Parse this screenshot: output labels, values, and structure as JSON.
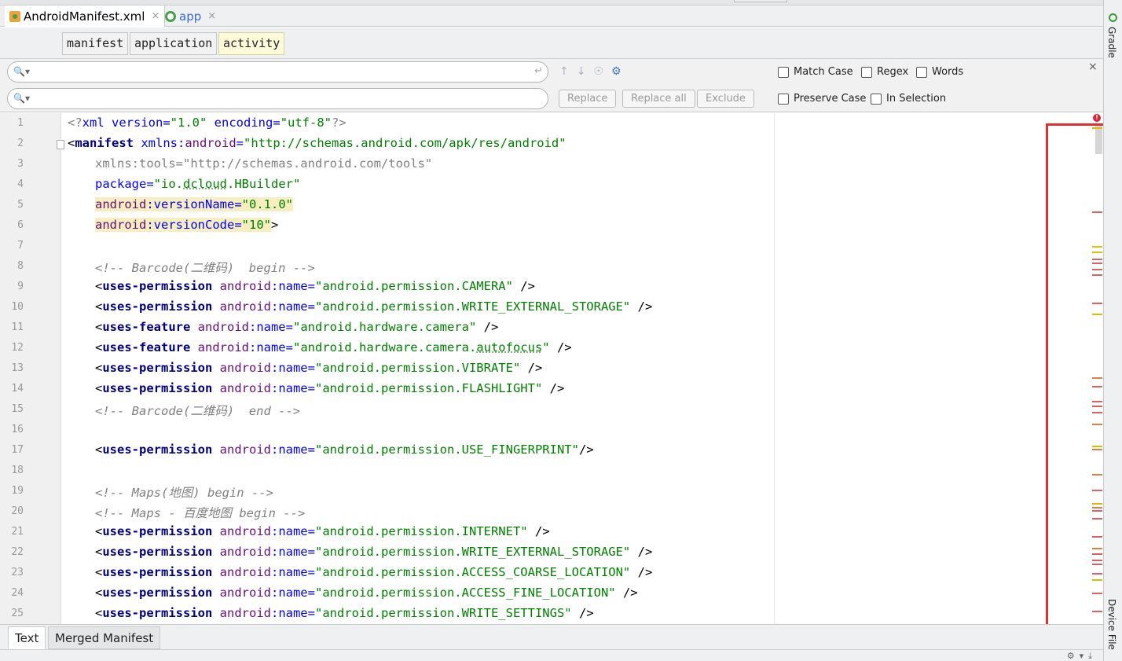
{
  "editor_tabs": [
    {
      "label": "AndroidManifest.xml",
      "icon": "xml-file-icon",
      "active": true
    },
    {
      "label": "app",
      "icon": "android-module-icon",
      "active": false
    }
  ],
  "close_glyph": "×",
  "breadcrumbs": [
    "manifest",
    "application",
    "activity"
  ],
  "find": {
    "search_value": "",
    "replace_value": "",
    "buttons": {
      "replace": "Replace",
      "replace_all": "Replace all",
      "exclude": "Exclude"
    },
    "options": {
      "match_case": "Match Case",
      "regex": "Regex",
      "words": "Words",
      "preserve_case": "Preserve Case",
      "in_selection": "In Selection"
    },
    "close": "×"
  },
  "gutter_lines": [
    "1",
    "2",
    "3",
    "4",
    "5",
    "6",
    "7",
    "8",
    "9",
    "10",
    "11",
    "12",
    "13",
    "14",
    "15",
    "16",
    "17",
    "18",
    "19",
    "20",
    "21",
    "22",
    "23",
    "24",
    "25"
  ],
  "code": {
    "l1": {
      "a": "<?",
      "b": "xml",
      "c": " version",
      "d": "=",
      "e": "\"1.0\"",
      "f": " encoding",
      "g": "=",
      "h": "\"utf-8\"",
      "i": "?>"
    },
    "l2": {
      "a": "<",
      "b": "manifest",
      "c": " xmlns:",
      "d": "android",
      "e": "=",
      "f": "\"http://schemas.android.com/apk/res/android\""
    },
    "l3": {
      "a": "xmlns:tools=\"http://schemas.android.com/tools\""
    },
    "l4": {
      "a": "package",
      "b": "=",
      "c": "\"io.",
      "d": "dcloud",
      "e": ".HBuilder\""
    },
    "l5": {
      "a": "android",
      "b": ":",
      "c": "versionName",
      "d": "=",
      "e": "\"0.1.0\""
    },
    "l6": {
      "a": "android",
      "b": ":",
      "c": "versionCode",
      "d": "=",
      "e": "\"10\"",
      "f": ">"
    },
    "l8": {
      "a": "<!-- Barcode(二维码)  begin -->"
    },
    "l9": {
      "a": "<",
      "b": "uses-permission",
      "c": " android",
      "d": ":name",
      "e": "=",
      "f": "\"android.permission.CAMERA\"",
      "g": " />"
    },
    "l10": {
      "a": "<",
      "b": "uses-permission",
      "c": " android",
      "d": ":name",
      "e": "=",
      "f": "\"android.permission.WRITE_EXTERNAL_STORAGE\"",
      "g": " />"
    },
    "l11": {
      "a": "<",
      "b": "uses-feature",
      "c": " android",
      "d": ":name",
      "e": "=",
      "f": "\"android.hardware.camera\"",
      "g": " />"
    },
    "l12": {
      "a": "<",
      "b": "uses-feature",
      "c": " android",
      "d": ":name",
      "e": "=",
      "f": "\"android.hardware.camera.",
      "h": "autofocus",
      "i": "\"",
      "g": " />"
    },
    "l13": {
      "a": "<",
      "b": "uses-permission",
      "c": " android",
      "d": ":name",
      "e": "=",
      "f": "\"android.permission.VIBRATE\"",
      "g": " />"
    },
    "l14": {
      "a": "<",
      "b": "uses-permission",
      "c": " android",
      "d": ":name",
      "e": "=",
      "f": "\"android.permission.FLASHLIGHT\"",
      "g": " />"
    },
    "l15": {
      "a": "<!-- Barcode(二维码)  end -->"
    },
    "l17": {
      "a": "<",
      "b": "uses-permission",
      "c": " android",
      "d": ":name",
      "e": "=",
      "f": "\"android.permission.USE_FINGERPRINT\"",
      "g": "/>"
    },
    "l19": {
      "a": "<!-- Maps(地图) begin -->"
    },
    "l20": {
      "a": "<!-- Maps - 百度地图 begin -->"
    },
    "l21": {
      "a": "<",
      "b": "uses-permission",
      "c": " android",
      "d": ":name",
      "e": "=",
      "f": "\"android.permission.INTERNET\"",
      "g": " />"
    },
    "l22": {
      "a": "<",
      "b": "uses-permission",
      "c": " android",
      "d": ":name",
      "e": "=",
      "f": "\"android.permission.WRITE_EXTERNAL_STORAGE\"",
      "g": " />"
    },
    "l23": {
      "a": "<",
      "b": "uses-permission",
      "c": " android",
      "d": ":name",
      "e": "=",
      "f": "\"android.permission.ACCESS_COARSE_LOCATION\"",
      "g": " />"
    },
    "l24": {
      "a": "<",
      "b": "uses-permission",
      "c": " android",
      "d": ":name",
      "e": "=",
      "f": "\"android.permission.ACCESS_FINE_LOCATION\"",
      "g": " />"
    },
    "l25": {
      "a": "<",
      "b": "uses-permission",
      "c": " android",
      "d": ":name",
      "e": "=",
      "f": "\"android.permission.WRITE_SETTINGS\"",
      "g": " />"
    }
  },
  "error_marker": "!",
  "right_tool_windows": {
    "gradle": "Gradle",
    "device_file": "Device File"
  },
  "bottom_tabs": {
    "text": "Text",
    "merged": "Merged Manifest"
  },
  "colors": {
    "tag": "#000080",
    "attribute": "#0000ff",
    "namespace": "#660e7a",
    "value": "#008000",
    "comment": "#808080",
    "highlight": "#f6eebf",
    "annotation_box": "#e03030"
  }
}
